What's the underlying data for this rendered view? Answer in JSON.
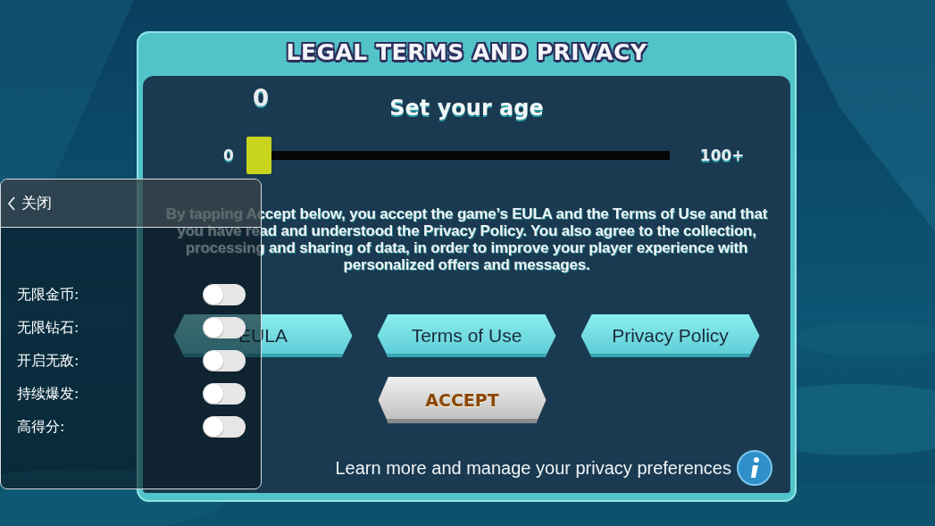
{
  "dialog": {
    "title": "LEGAL TERMS AND PRIVACY",
    "age_slider": {
      "label": "Set your age",
      "value": "0",
      "min_label": "0",
      "max_label": "100+",
      "level": 0
    },
    "consent_text": "By tapping Accept below, you accept the game’s EULA and the Terms of Use and that you have read and understood the Privacy Policy. You also agree to the collection, processing and sharing of data, in order to improve your player experience with personalized offers and messages.",
    "buttons": [
      {
        "label": "EULA",
        "kind": "link"
      },
      {
        "label": "Terms of Use",
        "kind": "link"
      },
      {
        "label": "Privacy Policy",
        "kind": "link"
      },
      {
        "label": "ACCEPT",
        "kind": "accept"
      }
    ],
    "privacy_link": "Learn more and manage your privacy preferences"
  },
  "cheat_menu": {
    "close_label": "关闭",
    "items": [
      {
        "label": "无限金币:",
        "on": false
      },
      {
        "label": "无限钻石:",
        "on": false
      },
      {
        "label": "开启无敌:",
        "on": false
      },
      {
        "label": "持续爆发:",
        "on": false
      },
      {
        "label": "高得分:",
        "on": false
      }
    ]
  }
}
